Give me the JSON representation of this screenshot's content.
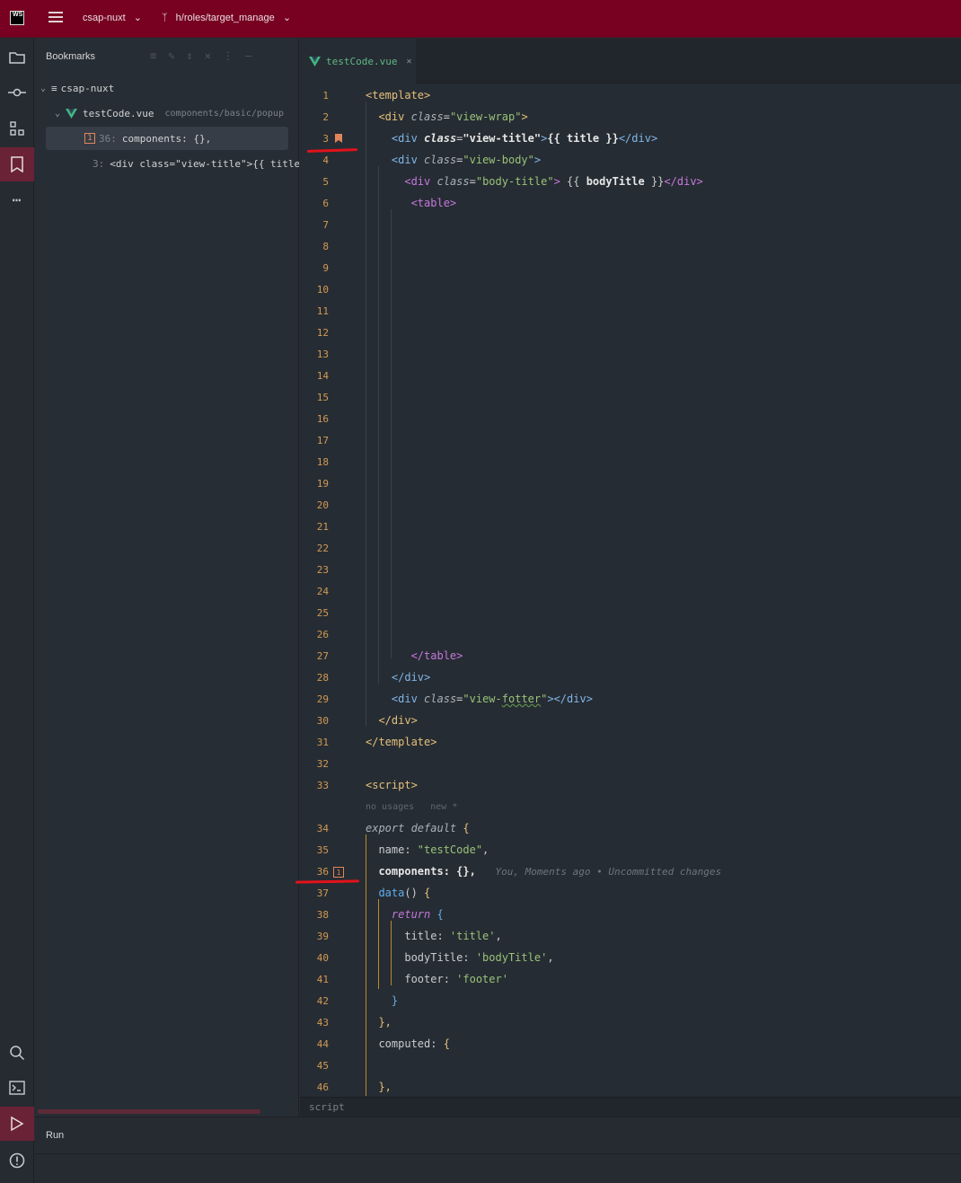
{
  "topbar": {
    "logo": "WS",
    "project": "csap-nuxt",
    "branch": "h/roles/target_manage"
  },
  "bookmarks_panel": {
    "title": "Bookmarks",
    "root": "csap-nuxt",
    "file": "testCode.vue",
    "file_path": "components/basic/popup",
    "items": [
      {
        "mnemonic": "1",
        "line": "36:",
        "text": "components: {},"
      },
      {
        "line": "3:",
        "text": "<div class=\"view-title\">{{ title }"
      }
    ]
  },
  "editor": {
    "tab_label": "testCode.vue",
    "inlay_hint": "no usages   new *",
    "blame": "You, Moments ago • Uncommitted changes",
    "bookmark_36_mnemonic": "1",
    "status_breadcrumb": "script"
  },
  "run_panel": {
    "label": "Run"
  },
  "colors": {
    "topbar": "#780021",
    "bookmark": "#e0865a",
    "vue_green": "#41b883",
    "underline_red": "#e3121b"
  }
}
